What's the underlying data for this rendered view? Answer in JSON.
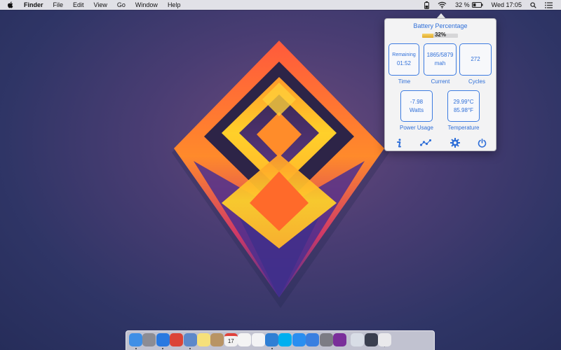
{
  "menubar": {
    "apple_icon": "apple-logo-icon",
    "app_name": "Finder",
    "menus": [
      "File",
      "Edit",
      "View",
      "Go",
      "Window",
      "Help"
    ],
    "battery_percent_text": "32 %",
    "clock": "Wed 17:05",
    "status_icons": [
      "battery-app-icon",
      "wifi-icon",
      "battery-icon",
      "spotlight-search-icon",
      "notification-center-icon"
    ]
  },
  "popover": {
    "title": "Battery Percentage",
    "percent_text": "32%",
    "percent_value": 0.32,
    "colors": {
      "accent": "#2f6fd8",
      "bar_fill": "#e8b53a"
    },
    "stats": {
      "time": {
        "line1": "Remaining",
        "line2": "01:52",
        "label": "Time"
      },
      "current": {
        "line1": "1865/5879",
        "line2": "mah",
        "label": "Current"
      },
      "cycles": {
        "line1": "272",
        "label": "Cycles"
      },
      "power": {
        "line1": "-7.98",
        "line2": "Watts",
        "label": "Power Usage"
      },
      "temperature": {
        "line1": "29.99°C",
        "line2": "85.98°F",
        "label": "Temperature"
      }
    },
    "buttons": [
      "info-icon",
      "graph-icon",
      "gear-icon",
      "power-icon"
    ]
  },
  "dock": {
    "apps": [
      {
        "name": "finder-icon",
        "color": "#3f8fe6",
        "running": true
      },
      {
        "name": "launchpad-icon",
        "color": "#8c8c94",
        "running": false
      },
      {
        "name": "safari-icon",
        "color": "#2a79e0",
        "running": true
      },
      {
        "name": "chrome-icon",
        "color": "#db4437",
        "running": false
      },
      {
        "name": "preview-icon",
        "color": "#5d88c9",
        "running": true
      },
      {
        "name": "notes-icon",
        "color": "#f6e07a",
        "running": false
      },
      {
        "name": "contacts-icon",
        "color": "#b89465",
        "running": false
      },
      {
        "name": "calendar-icon",
        "color": "#f2f2f2",
        "running": false
      },
      {
        "name": "photos-icon",
        "color": "#f4f4f4",
        "running": false
      },
      {
        "name": "itunes-icon",
        "color": "#f3f3f5",
        "running": false
      },
      {
        "name": "xcode-icon",
        "color": "#2f7fd4",
        "running": true
      },
      {
        "name": "skype-icon",
        "color": "#00aff0",
        "running": false
      },
      {
        "name": "app-store-icon",
        "color": "#2a8ef0",
        "running": false
      },
      {
        "name": "quicktime-icon",
        "color": "#3a7fe0",
        "running": false
      },
      {
        "name": "system-preferences-icon",
        "color": "#7c7c84",
        "running": false
      },
      {
        "name": "affinity-icon",
        "color": "#7a2f9a",
        "running": false
      },
      {
        "name": "downloads-folder-icon",
        "color": "#d8dde6",
        "running": false
      },
      {
        "name": "screenshot-folder-icon",
        "color": "#3a3f4f",
        "running": false
      },
      {
        "name": "trash-icon",
        "color": "#e9e9ec",
        "running": false
      }
    ],
    "calendar_day": "17"
  }
}
